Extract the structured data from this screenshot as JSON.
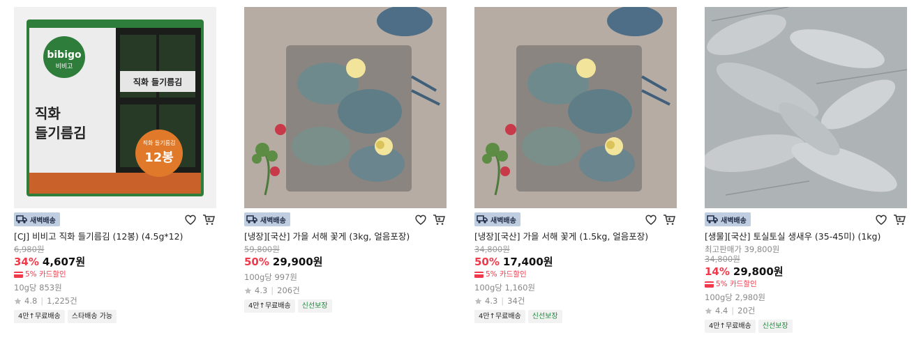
{
  "products": [
    {
      "badge": "새벽배송",
      "name": "[CJ] 비비고 직화 들기름김 (12봉) (4.5g*12)",
      "original_price": "6,980원",
      "discount": "34%",
      "price": "4,607원",
      "card_discount": "5% 카드할인",
      "unit_price": "10g당 853원",
      "rating": "4.8",
      "reviews": "1,225건",
      "tags": [
        "4만↑무료배송",
        "스타배송 가능"
      ],
      "image": {
        "brand": "bibigo",
        "brand_kr": "비비고",
        "title_line1": "직화",
        "title_line2": "들기름김",
        "pack_label": "직화 들기름김",
        "circle_line1": "직화 들기름김",
        "circle_line2": "12봉"
      }
    },
    {
      "badge": "새벽배송",
      "name": "[냉장][국산] 가을 서해 꽃게 (3kg, 얼음포장)",
      "original_price": "59,800원",
      "discount": "50%",
      "price": "29,900원",
      "unit_price": "100g당 997원",
      "rating": "4.3",
      "reviews": "206건",
      "tags": [
        "4만↑무료배송",
        "신선보장"
      ]
    },
    {
      "badge": "새벽배송",
      "name": "[냉장][국산] 가을 서해 꽃게 (1.5kg, 얼음포장)",
      "original_price": "34,800원",
      "discount": "50%",
      "price": "17,400원",
      "card_discount": "5% 카드할인",
      "unit_price": "100g당 1,160원",
      "rating": "4.3",
      "reviews": "34건",
      "tags": [
        "4만↑무료배송",
        "신선보장"
      ]
    },
    {
      "badge": "새벽배송",
      "name": "[생물][국산] 토실토실 생새우 (35-45미) (1kg)",
      "lowest_price": "최고판매가 39,800원",
      "original_price": "34,800원",
      "discount": "14%",
      "price": "29,800원",
      "card_discount": "5% 카드할인",
      "unit_price": "100g당 2,980원",
      "rating": "4.4",
      "reviews": "20건",
      "tags": [
        "4만↑무료배송",
        "신선보장"
      ]
    }
  ],
  "colors": {
    "discount": "#f03a4b",
    "badge_bg": "#bfcde0",
    "fresh_tag": "#1a8a3a"
  },
  "icons": {
    "heart": "heart-icon",
    "cart": "cart-icon",
    "truck": "truck-icon",
    "card": "card-icon",
    "star": "star-icon"
  }
}
